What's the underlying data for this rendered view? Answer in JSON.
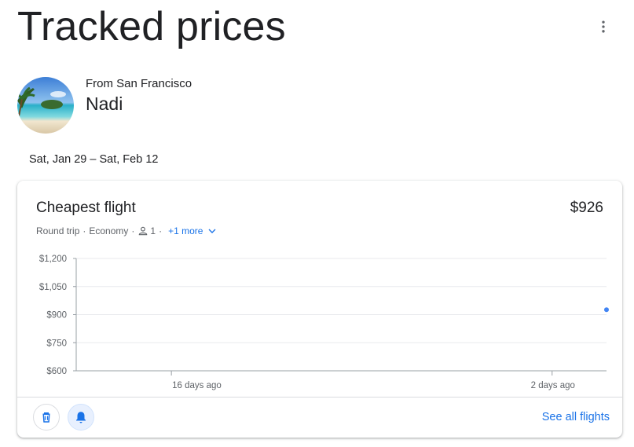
{
  "page": {
    "title": "Tracked prices"
  },
  "trip": {
    "origin": "From San Francisco",
    "destination": "Nadi",
    "dates": "Sat, Jan 29 – Sat, Feb 12"
  },
  "card": {
    "title": "Cheapest flight",
    "price": "$926",
    "trip_type": "Round trip",
    "cabin": "Economy",
    "passengers": "1",
    "more_link": "+1 more",
    "see_all": "See all flights"
  },
  "icons": {
    "more": "more-vert-icon",
    "passenger": "person-icon",
    "expand": "chevron-down-icon",
    "delete": "trash-icon",
    "notify": "bell-icon"
  },
  "colors": {
    "accent": "#1a73e8",
    "point": "#4285f4",
    "text": "#202124",
    "muted": "#5f6368",
    "grid": "#e8eaed",
    "axis": "#9aa0a6"
  },
  "chart_data": {
    "type": "scatter",
    "ylabel": "",
    "xlabel": "",
    "ylim": [
      600,
      1200
    ],
    "y_ticks": [
      "$1,200",
      "$1,050",
      "$900",
      "$750",
      "$600"
    ],
    "y_tick_values": [
      1200,
      1050,
      900,
      750,
      600
    ],
    "x_ticks": [
      "16 days ago",
      "2 days ago"
    ],
    "x_tick_values": [
      -16,
      -2
    ],
    "xlim": [
      -19.5,
      0
    ],
    "series": [
      {
        "x": [
          0
        ],
        "values": [
          926
        ]
      }
    ],
    "grid": true
  }
}
